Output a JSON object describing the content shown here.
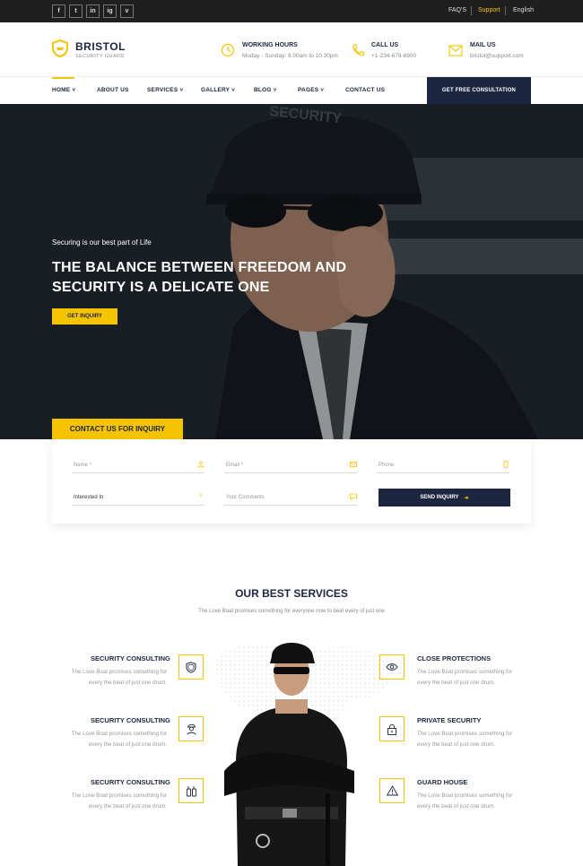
{
  "topbar": {
    "social": [
      "f",
      "t",
      "in",
      "ig",
      "v"
    ],
    "links": {
      "faq": "FAQ'S",
      "support": "Support",
      "language": "English"
    }
  },
  "brand": {
    "name": "BRISTOL",
    "tagline": "SECURITY GUARD"
  },
  "contact_info": {
    "hours_title": "WORKING HOURS",
    "hours_text": "Moday - Sunday: 8.00am to 10.30pm",
    "call_title": "CALL US",
    "call_text": "+1-234-678-8900",
    "mail_title": "MAIL US",
    "mail_text": "bristol@support.com"
  },
  "nav": {
    "items": [
      {
        "label": "HOME",
        "dropdown": true
      },
      {
        "label": "ABOUT US",
        "dropdown": false
      },
      {
        "label": "SERVICES",
        "dropdown": true
      },
      {
        "label": "GALLERY",
        "dropdown": true
      },
      {
        "label": "BLOG",
        "dropdown": true
      },
      {
        "label": "PAGES",
        "dropdown": true
      },
      {
        "label": "CONTACT US",
        "dropdown": false
      }
    ],
    "cta": "GET FREE CONSULTATION"
  },
  "hero": {
    "kicker": "Securing is our best part of Life",
    "title_line1": "THE BALANCE BETWEEN FREEDOM AND",
    "title_line2": "SECURITY IS A DELICATE ONE",
    "button": "GET INQUIRY"
  },
  "inquiry": {
    "tab": "CONTACT US FOR INQUIRY",
    "name_ph": "Name *",
    "email_ph": "Email *",
    "phone_ph": "Phone",
    "interest_ph": "Interested In",
    "comments_ph": "Your Comments",
    "send": "SEND INQUIRY"
  },
  "services": {
    "title": "OUR BEST SERVICES",
    "subtitle": "The Love Boat promises something for everyone now to beat every of just one",
    "left": [
      {
        "title": "SECURITY CONSULTING",
        "desc1": "The Love Boat promises something for",
        "desc2": "every the beat of just one drum."
      },
      {
        "title": "SECURITY CONSULTING",
        "desc1": "The Love Boat promises something for",
        "desc2": "every the beat of just one drum."
      },
      {
        "title": "SECURITY CONSULTING",
        "desc1": "The Love Boat promises something for",
        "desc2": "every the beat of just one drum."
      }
    ],
    "right": [
      {
        "title": "CLOSE PROTECTIONS",
        "desc1": "The Love Boat promises something for",
        "desc2": "every the beat of just one drum."
      },
      {
        "title": "PRIVATE SECURITY",
        "desc1": "The Love Boat promises something for",
        "desc2": "every the beat of just one drum."
      },
      {
        "title": "GUARD HOUSE",
        "desc1": "The Love Boat promises something for",
        "desc2": "every the beat of just one drum."
      }
    ]
  },
  "colors": {
    "accent": "#f5c300",
    "navy": "#1d2640",
    "topbar": "#1f1f1f"
  }
}
